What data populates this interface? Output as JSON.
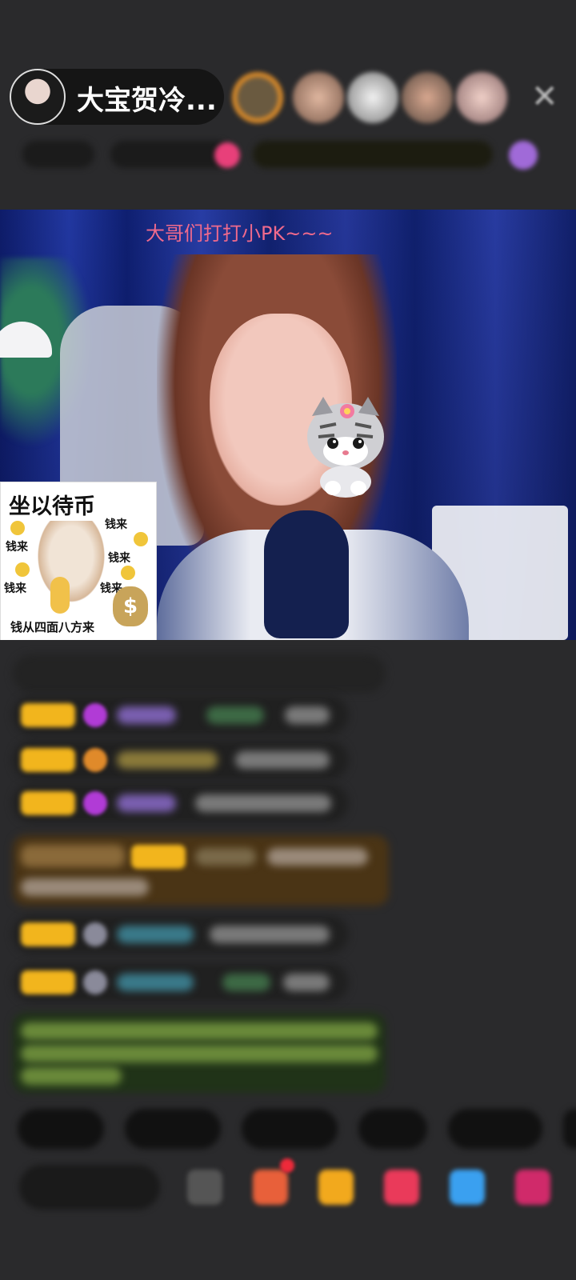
{
  "header": {
    "host_name": "大宝贺冷...",
    "close_icon": "close-icon"
  },
  "video": {
    "overlay_text": "大哥们打打小PK~~~",
    "sticker_card": {
      "title": "坐以待币",
      "labels": [
        "钱来",
        "钱来",
        "钱来",
        "钱来",
        "钱来"
      ],
      "bottom_text": "钱从四面八方来",
      "bag_symbol": "$"
    }
  },
  "colors": {
    "overlay_text": "#f06a8c",
    "background": "#2a2a2c",
    "badge": "#f2b51d"
  }
}
